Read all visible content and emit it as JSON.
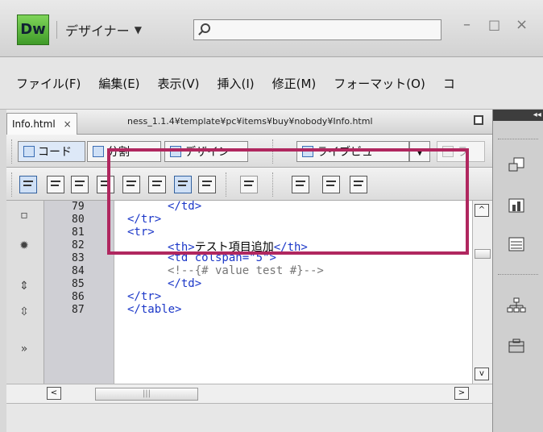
{
  "app": {
    "logo_text": "Dw",
    "workspace_label": "デザイナー",
    "workspace_caret": "▼",
    "window_minimize": "–",
    "window_maximize": "□",
    "window_close": "×"
  },
  "menu": {
    "items": [
      "ファイル(F)",
      "編集(E)",
      "表示(V)",
      "挿入(I)",
      "修正(M)",
      "フォーマット(O)",
      "コ"
    ]
  },
  "document": {
    "tab_label": "Info.html",
    "tab_close": "×",
    "path": "ness_1.1.4¥template¥pc¥items¥buy¥nobody¥Info.html"
  },
  "toolbar": {
    "code_label": "コード",
    "split_label": "分割",
    "design_label": "デザイン",
    "liveview_label": "ライブビュー",
    "liveview_caret": "▼",
    "extra_label": "ラ"
  },
  "editor": {
    "line_numbers": [
      "79",
      "80",
      "81",
      "82",
      "83",
      "84",
      "85",
      "86",
      "87"
    ],
    "lines": {
      "l79": "</td>",
      "l80": "</tr>",
      "l81": "<tr>",
      "l82_open": "<th>",
      "l82_text": "テスト項目追加",
      "l82_close": "</th>",
      "l83_open": "<td colspan=",
      "l83_val": "\"5\"",
      "l83_close": ">",
      "l84": "<!--{# value test #}-->",
      "l85": "</td>",
      "l86": "</tr>",
      "l87": "</table>"
    }
  },
  "scrollbars": {
    "up": "^",
    "down": "v",
    "left": "<",
    "right": ">",
    "thumb_grip": "|||"
  },
  "colors": {
    "highlight": "#b0275f",
    "tag": "#1b37c8",
    "logo": "#5fbf3e"
  }
}
